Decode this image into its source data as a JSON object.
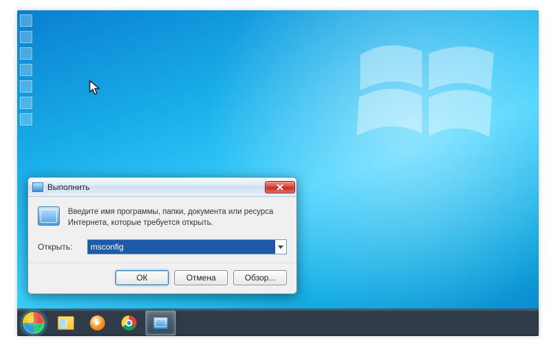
{
  "dialog": {
    "title": "Выполнить",
    "instruction": "Введите имя программы, папки, документа или ресурса Интернета, которые требуется открыть.",
    "field_label": "Открыть:",
    "field_value": "msconfig",
    "buttons": {
      "ok": "ОК",
      "cancel": "Отмена",
      "browse": "Обзор..."
    }
  },
  "taskbar": {
    "items": [
      {
        "name": "start",
        "label": "Пуск"
      },
      {
        "name": "explorer",
        "label": "Проводник"
      },
      {
        "name": "wmp",
        "label": "Проигрыватель Windows Media"
      },
      {
        "name": "chrome",
        "label": "Google Chrome"
      },
      {
        "name": "run",
        "label": "Выполнить",
        "active": true
      }
    ]
  }
}
